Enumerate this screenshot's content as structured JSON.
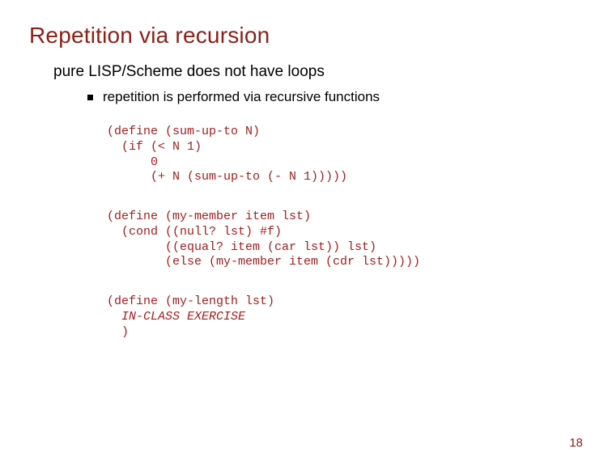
{
  "title": "Repetition via recursion",
  "subtitle": "pure LISP/Scheme does not have loops",
  "bullet": "repetition is performed via recursive functions",
  "code1": "(define (sum-up-to N)\n  (if (< N 1)\n      0\n      (+ N (sum-up-to (- N 1)))))",
  "code2": "(define (my-member item lst)\n  (cond ((null? lst) #f)\n        ((equal? item (car lst)) lst)\n        (else (my-member item (cdr lst)))))",
  "code3_line1": "(define (my-length lst)",
  "code3_line2": "  IN-CLASS EXERCISE",
  "code3_line3": "  )",
  "page_number": "18"
}
